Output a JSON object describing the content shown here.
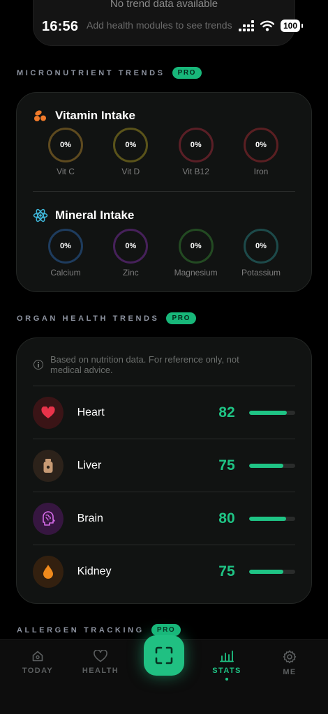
{
  "status_bar": {
    "time": "16:56",
    "battery": "100"
  },
  "top_card": {
    "line1": "No trend data available",
    "line2": "Add health modules to see trends"
  },
  "micronutrients": {
    "heading": "MICRONUTRIENT TRENDS",
    "badge": "PRO",
    "vitamin": {
      "title": "Vitamin Intake",
      "items": [
        {
          "value": "0%",
          "label": "Vit C",
          "color": "#5e4a1f"
        },
        {
          "value": "0%",
          "label": "Vit D",
          "color": "#5a531a"
        },
        {
          "value": "0%",
          "label": "Vit B12",
          "color": "#5a1f26"
        },
        {
          "value": "0%",
          "label": "Iron",
          "color": "#5a1f22"
        }
      ]
    },
    "mineral": {
      "title": "Mineral Intake",
      "items": [
        {
          "value": "0%",
          "label": "Calcium",
          "color": "#1e3c5e"
        },
        {
          "value": "0%",
          "label": "Zinc",
          "color": "#46215a"
        },
        {
          "value": "0%",
          "label": "Magnesium",
          "color": "#234a22"
        },
        {
          "value": "0%",
          "label": "Potassium",
          "color": "#1d4a4a"
        }
      ]
    }
  },
  "organ_health": {
    "heading": "ORGAN HEALTH TRENDS",
    "badge": "PRO",
    "disclaimer": "Based on nutrition data. For reference only, not medical advice.",
    "organs": [
      {
        "name": "Heart",
        "score": "82",
        "level": 0.82,
        "icon": "heart-icon",
        "bg": "#3a1416"
      },
      {
        "name": "Liver",
        "score": "75",
        "level": 0.75,
        "icon": "liver-bottle-icon",
        "bg": "#2c221a"
      },
      {
        "name": "Brain",
        "score": "80",
        "level": 0.8,
        "icon": "brain-icon",
        "bg": "#361640"
      },
      {
        "name": "Kidney",
        "score": "75",
        "level": 0.75,
        "icon": "kidney-drop-icon",
        "bg": "#33200f"
      }
    ]
  },
  "allergen": {
    "heading": "ALLERGEN TRACKING",
    "badge": "PRO"
  },
  "nav": {
    "today": "TODAY",
    "health": "HEALTH",
    "stats": "STATS",
    "me": "ME"
  },
  "colors": {
    "accent": "#1fc485",
    "background": "#000000",
    "card": "#111312"
  }
}
